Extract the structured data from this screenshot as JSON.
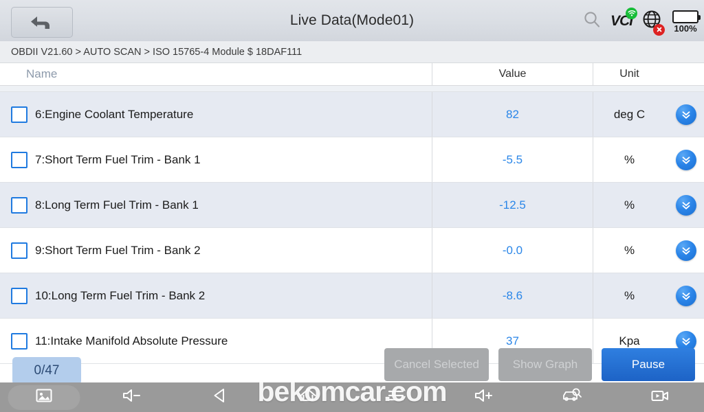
{
  "header": {
    "title": "Live Data(Mode01)",
    "back_icon": "back-arrow-icon",
    "search_icon": "search-icon",
    "vci_label": "VCI",
    "wifi_badge_icon": "wifi-icon",
    "globe_icon": "globe-icon",
    "globe_badge_icon": "close-x-icon",
    "battery_icon": "battery-full-icon",
    "battery_percent": "100%",
    "accent_green": "#17bd38",
    "accent_red": "#dd2222"
  },
  "breadcrumb": {
    "text": "OBDII V21.60 > AUTO SCAN  > ISO 15765-4 Module $ 18DAF111"
  },
  "table": {
    "columns": {
      "name": "Name",
      "value": "Value",
      "unit": "Unit"
    },
    "rows": [
      {
        "name": "6:Engine Coolant Temperature",
        "value": "82",
        "unit": "deg C",
        "checked": false,
        "expand_icon": "chevron-double-down-icon"
      },
      {
        "name": "7:Short Term Fuel Trim - Bank 1",
        "value": "-5.5",
        "unit": "%",
        "checked": false,
        "expand_icon": "chevron-double-down-icon"
      },
      {
        "name": "8:Long Term Fuel Trim - Bank 1",
        "value": "-12.5",
        "unit": "%",
        "checked": false,
        "expand_icon": "chevron-double-down-icon"
      },
      {
        "name": "9:Short Term Fuel Trim - Bank 2",
        "value": "-0.0",
        "unit": "%",
        "checked": false,
        "expand_icon": "chevron-double-down-icon"
      },
      {
        "name": "10:Long Term Fuel Trim - Bank 2",
        "value": "-8.6",
        "unit": "%",
        "checked": false,
        "expand_icon": "chevron-double-down-icon"
      },
      {
        "name": "11:Intake Manifold Absolute Pressure",
        "value": "37",
        "unit": "Kpa",
        "checked": false,
        "expand_icon": "chevron-double-down-icon"
      }
    ],
    "value_color": "#2a86e8"
  },
  "footer": {
    "counter": "0/47",
    "buttons": [
      {
        "label": "Cancel Selected",
        "style": "disabled"
      },
      {
        "label": "Show Graph",
        "style": "disabled"
      },
      {
        "label": "Pause",
        "style": "primary"
      }
    ]
  },
  "navbar": {
    "items": [
      {
        "icon": "screenshot-icon",
        "label": ""
      },
      {
        "icon": "volume-down-icon",
        "label": ""
      },
      {
        "icon": "back-triangle-icon",
        "label": ""
      },
      {
        "icon": "home-icon",
        "label": ""
      },
      {
        "icon": "menu-icon",
        "label": ""
      },
      {
        "icon": "volume-up-icon",
        "label": ""
      },
      {
        "icon": "car-scan-icon",
        "label": ""
      },
      {
        "icon": "screen-record-icon",
        "label": ""
      }
    ]
  },
  "watermark": {
    "text": "bekomcar.com"
  }
}
